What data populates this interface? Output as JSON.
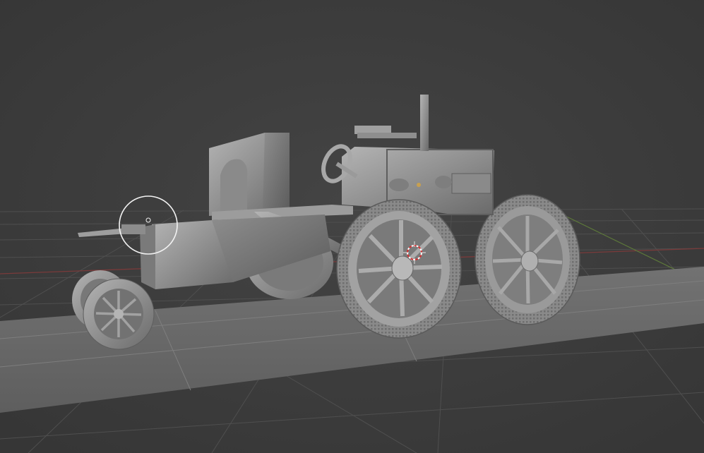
{
  "viewport": {
    "type": "3d-viewport",
    "shading": "solid",
    "background": "#3d3d3d",
    "grid_color": "#4f4f4f",
    "axis_x_color": "#7a3a3a",
    "axis_y_color": "#5e7a3a",
    "model_color": "#9a9a9a",
    "ground_plane_color": "#6c6c6c"
  },
  "scene": {
    "objects": [
      {
        "name": "tractor-body",
        "selected": false
      },
      {
        "name": "ground-plane",
        "selected": false
      }
    ]
  },
  "gizmos": {
    "brush_cursor_icon": "circle-brush-cursor",
    "origin_icon": "3d-cursor-crosshair"
  }
}
